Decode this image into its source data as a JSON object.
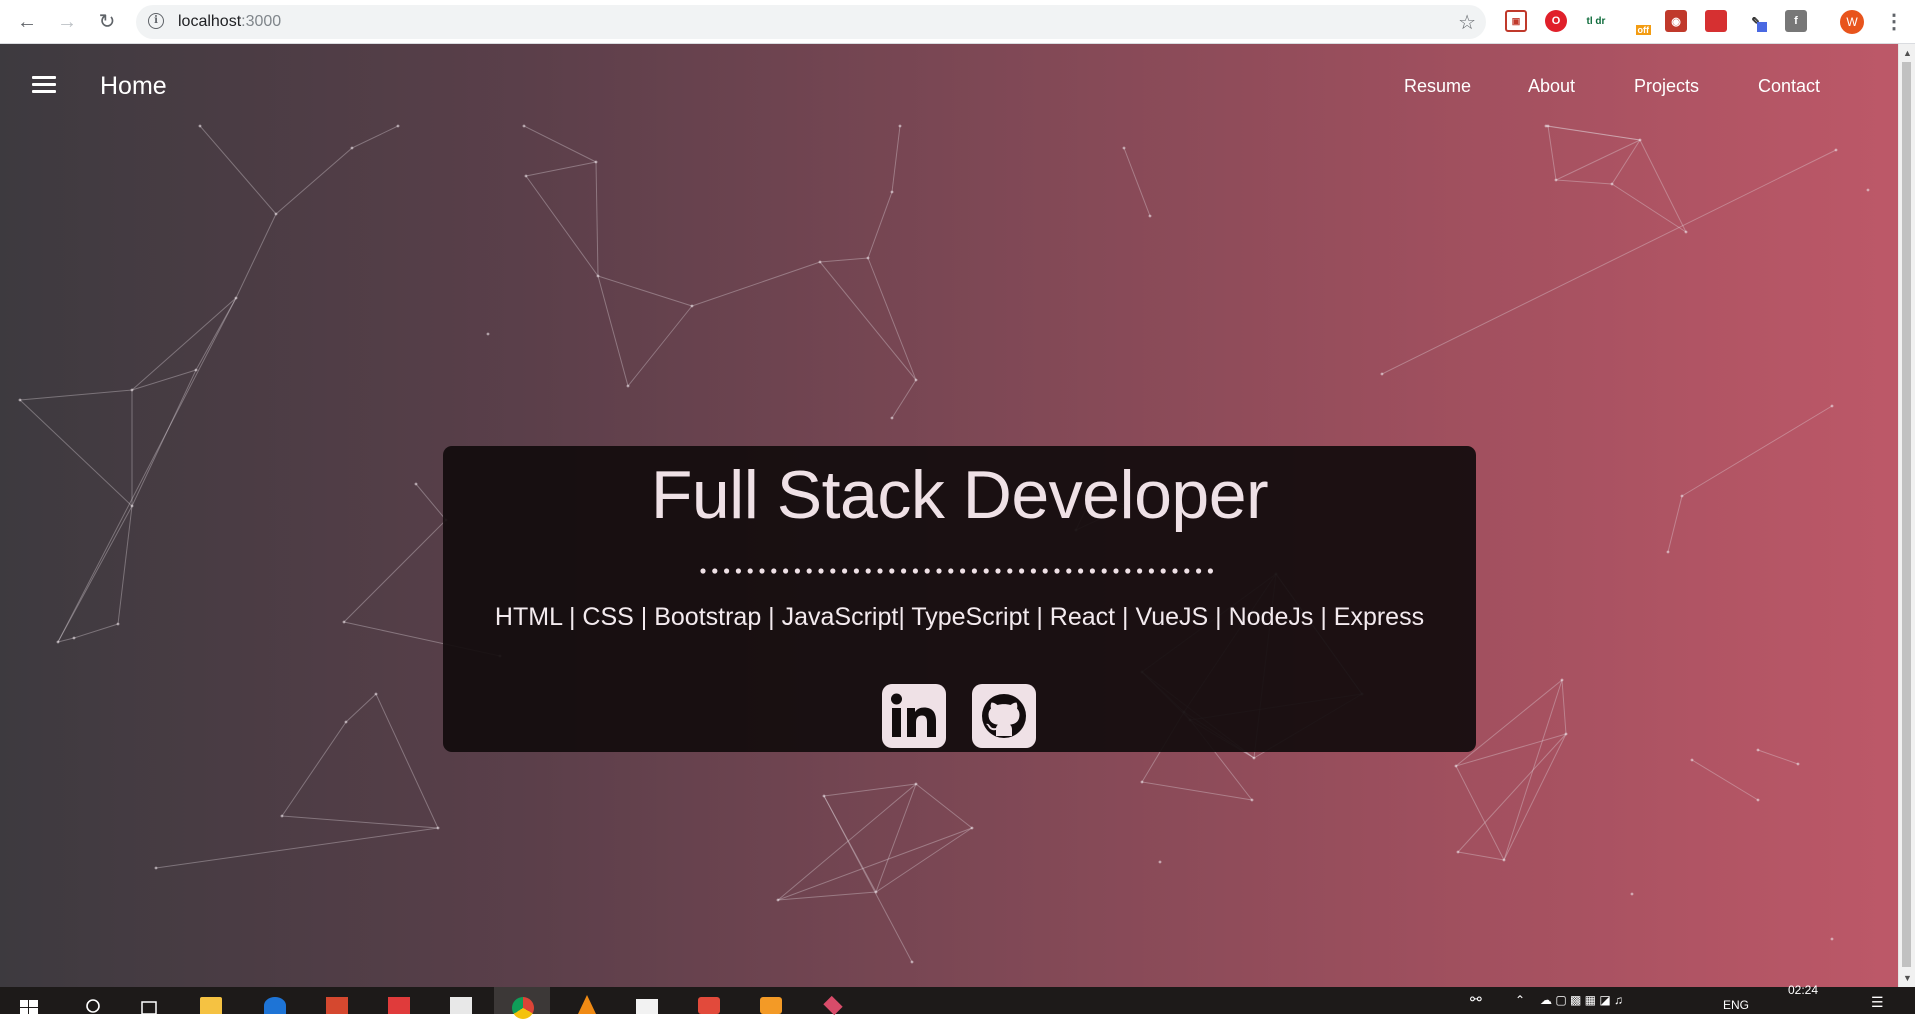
{
  "browser": {
    "url_host": "localhost",
    "url_port": ":3000",
    "profile_initial": "W",
    "extensions": [
      "reader-icon",
      "opera-icon",
      "tldr-icon",
      "coupon-off-icon",
      "screenshot-icon",
      "bookmark-red-icon",
      "color-picker-icon",
      "facebook-icon"
    ],
    "extension_badges": {
      "tldr": "tl dr",
      "coupon": "off"
    }
  },
  "site_nav": {
    "brand": "Home",
    "links": [
      "Resume",
      "About",
      "Projects",
      "Contact"
    ]
  },
  "hero": {
    "title": "Full Stack Developer",
    "skills": "HTML | CSS | Bootstrap | JavaScript| TypeScript | React | VueJS | NodeJs | Express",
    "social": [
      "linkedin-icon",
      "github-icon"
    ]
  },
  "taskbar": {
    "language": "ENG",
    "time": "02:24",
    "apps": [
      "windows-start-icon",
      "search-icon",
      "task-view-icon",
      "file-explorer-icon",
      "edge-icon",
      "app-red-icon",
      "app-book-icon",
      "store-icon",
      "chrome-icon",
      "vlc-icon",
      "mail-icon",
      "app-p-icon",
      "app-orange-icon",
      "app-tool-icon"
    ]
  },
  "colors": {
    "gradient_start": "#3d3a3f",
    "gradient_end": "#bd5868",
    "hero_bg": "#120c0d",
    "hero_text": "#efe1e6"
  }
}
